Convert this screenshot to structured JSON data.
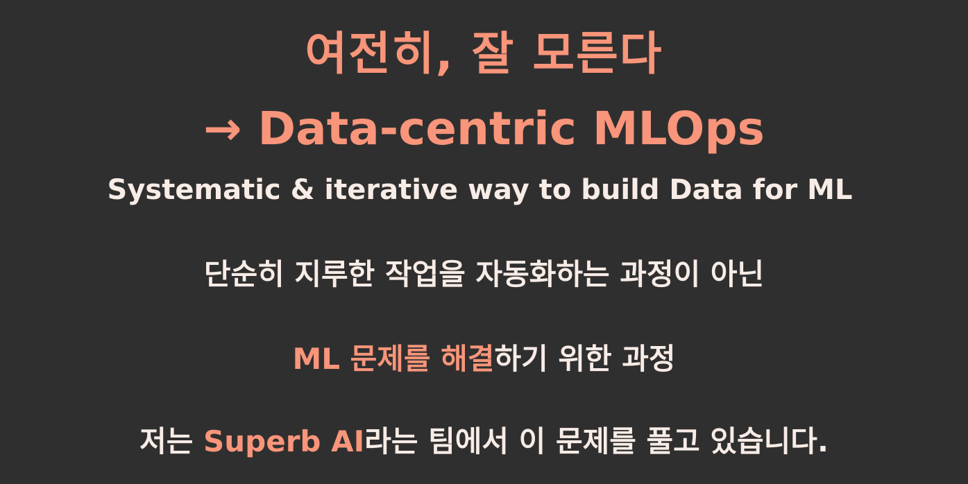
{
  "slide": {
    "title_line1": "여전히, 잘 모른다",
    "title_line2": "→ Data-centric MLOps",
    "subtitle": "Systematic & iterative way to build Data for ML",
    "body_line1": "단순히 지루한 작업을 자동화하는 과정이 아닌",
    "body_line2": {
      "highlight": "ML 문제를 해결",
      "rest": "하기 위한 과정"
    },
    "body_line3": {
      "prefix": "저는 ",
      "highlight": "Superb AI",
      "rest": "라는 팀에서 이 문제를 풀고 있습니다."
    }
  },
  "colors": {
    "background": "#302f2f",
    "accent": "#f8957a",
    "text": "#f7ece6"
  }
}
